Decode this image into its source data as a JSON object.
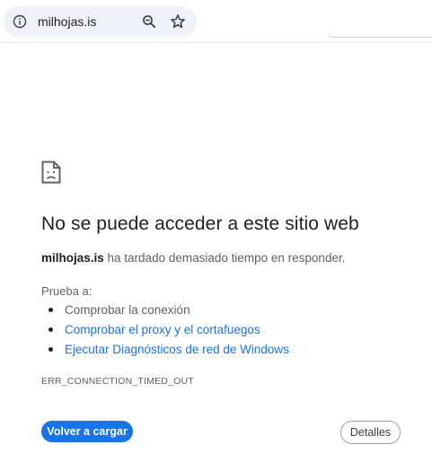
{
  "browser": {
    "url": "milhojas.is",
    "icons": {
      "info": "info-icon",
      "zoom": "zoom-out-icon",
      "bookmark": "star-icon"
    }
  },
  "error": {
    "icon": "sad-page-icon",
    "title": "No se puede acceder a este sitio web",
    "summary_host": "milhojas.is",
    "summary_text": " ha tardado demasiado tiempo en responder.",
    "try_label": "Prueba a:",
    "suggestions": [
      {
        "label": "Comprobar la conexión",
        "link": false
      },
      {
        "label": "Comprobar el proxy y el cortafuegos",
        "link": true
      },
      {
        "label": "Ejecutar Diagnósticos de red de Windows",
        "link": true
      }
    ],
    "code": "ERR_CONNECTION_TIMED_OUT"
  },
  "buttons": {
    "reload": "Volver a cargar",
    "details": "Detalles"
  },
  "colors": {
    "accent": "#1a73e8",
    "omnibox": "#eef2f8",
    "text_primary": "#202124",
    "text_secondary": "#5f6368"
  }
}
